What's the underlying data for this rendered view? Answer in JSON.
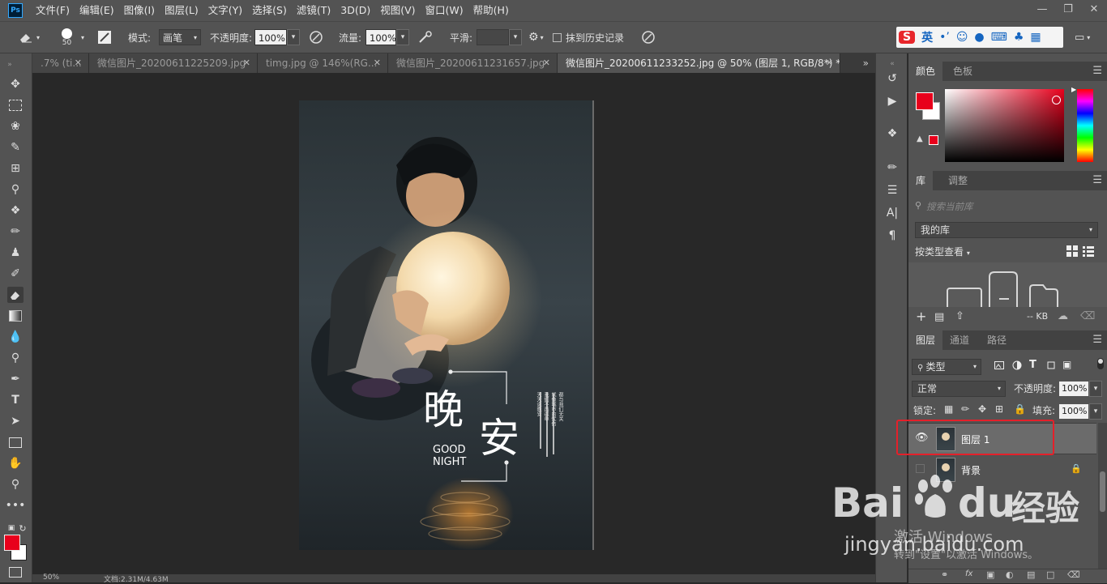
{
  "app": {
    "logo_text": "Ps",
    "menu": [
      "文件(F)",
      "编辑(E)",
      "图像(I)",
      "图层(L)",
      "文字(Y)",
      "选择(S)",
      "滤镜(T)",
      "3D(D)",
      "视图(V)",
      "窗口(W)",
      "帮助(H)"
    ]
  },
  "options_bar": {
    "brush_size": "50",
    "mode_label": "模式:",
    "mode_value": "画笔",
    "opacity_label": "不透明度:",
    "opacity_value": "100%",
    "flow_label": "流量:",
    "flow_value": "100%",
    "smooth_label": "平滑:",
    "smooth_value": "",
    "erase_history_label": "抹到历史记录"
  },
  "ime": {
    "brand": "S",
    "lang": "英"
  },
  "tabs": [
    {
      "label": ".7% (ti..."
    },
    {
      "label": "微信图片_20200611225209.jpg"
    },
    {
      "label": "timg.jpg @ 146%(RG..."
    },
    {
      "label": "微信图片_20200611231657.jpg"
    },
    {
      "label": "微信图片_20200611233252.jpg @ 50% (图层 1, RGB/8*) *"
    }
  ],
  "poster": {
    "char1": "晚",
    "char2": "安",
    "en1": "GOOD",
    "en2": "NIGHT",
    "side1": "天天说晚安",
    "side2": "我们不再孤单",
    "side3": "就像城市的忧伤",
    "side4": "都与我们无关"
  },
  "status": {
    "zoom": "50%",
    "doc": "文档:2.31M/4.63M"
  },
  "color_panel": {
    "tabs": [
      "颜色",
      "色板"
    ],
    "fg_color": "#e8001c",
    "bg_color": "#ffffff"
  },
  "library_panel": {
    "tabs": [
      "库",
      "调整"
    ],
    "search_placeholder": "搜索当前库",
    "library_name": "我的库",
    "view_by": "按类型查看",
    "size_label": "-- KB"
  },
  "layers_panel": {
    "tabs": [
      "图层",
      "通道",
      "路径"
    ],
    "filter_label": "类型",
    "blend_mode": "正常",
    "opacity_label": "不透明度:",
    "opacity_value": "100%",
    "lock_label": "锁定:",
    "fill_label": "填充:",
    "fill_value": "100%",
    "layers": [
      {
        "name": "图层 1"
      },
      {
        "name": "背景"
      }
    ],
    "highlight_color": "#e5202a"
  },
  "overlay": {
    "baidu_brand": "Bai",
    "baidu_du": "du",
    "baidu_cn": "经验",
    "baidu_url": "jingyan.baidu.com",
    "activate_title": "激活 Windows",
    "activate_sub": "转到\"设置\"以激活 Windows。"
  }
}
